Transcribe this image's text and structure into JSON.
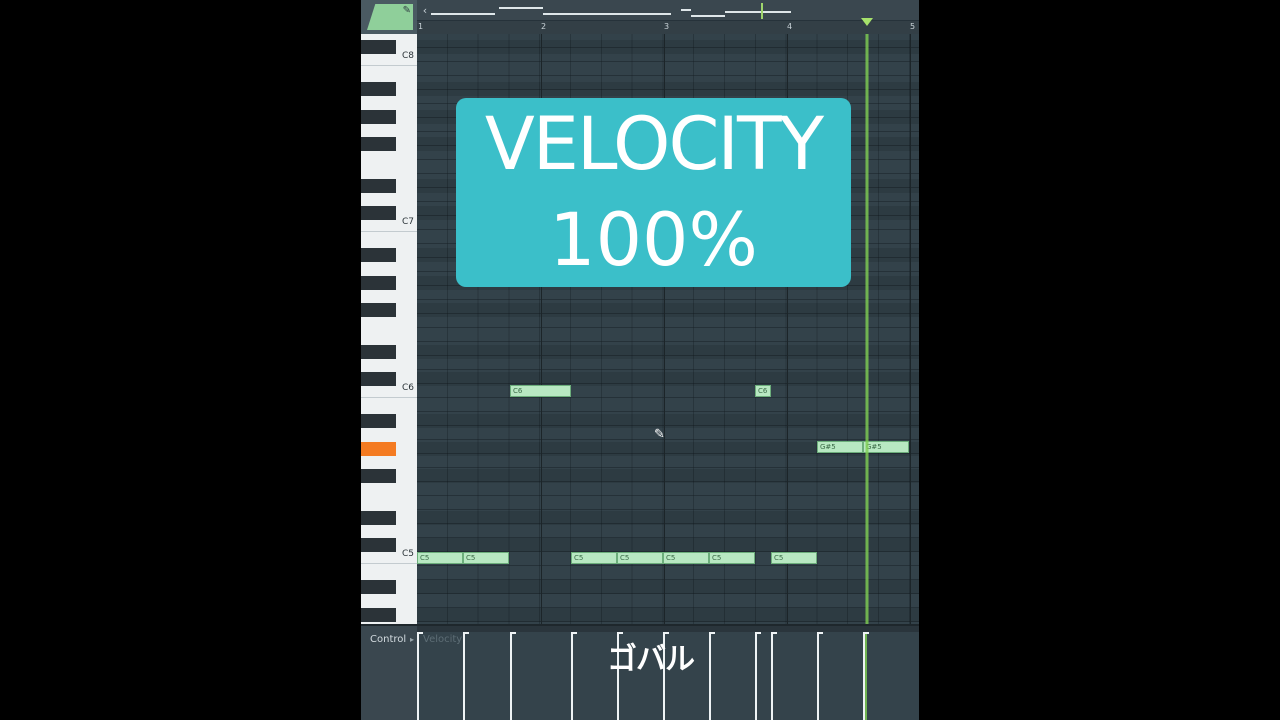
{
  "ruler": {
    "bars": [
      "1",
      "2",
      "3",
      "4",
      "5"
    ]
  },
  "keyboard": {
    "labels": [
      "C8",
      "C7",
      "C6",
      "C5"
    ],
    "highlight_color": "#f47b22"
  },
  "notes": [
    {
      "label": "C6"
    },
    {
      "label": "C6"
    },
    {
      "label": "G#5"
    },
    {
      "label": "G#5"
    },
    {
      "label": "C5"
    },
    {
      "label": "C5"
    },
    {
      "label": "C5"
    },
    {
      "label": "C5"
    },
    {
      "label": "C5"
    },
    {
      "label": "C5"
    },
    {
      "label": "C5"
    }
  ],
  "overlay": {
    "line1": "VELOCITY",
    "line2": "100%"
  },
  "control": {
    "label": "Control",
    "target": "Velocity"
  },
  "watermark": {
    "text": "ゴバル"
  },
  "colors": {
    "overlay_bg": "#3bbfc9",
    "note_fill": "#b8e8c2",
    "playhead": "#7fcf52",
    "grid_bg": "#33424a"
  },
  "icons": {
    "scroll_left": "chevron-left-icon",
    "tool": "pencil-icon",
    "cursor": "pencil-cursor-icon"
  }
}
